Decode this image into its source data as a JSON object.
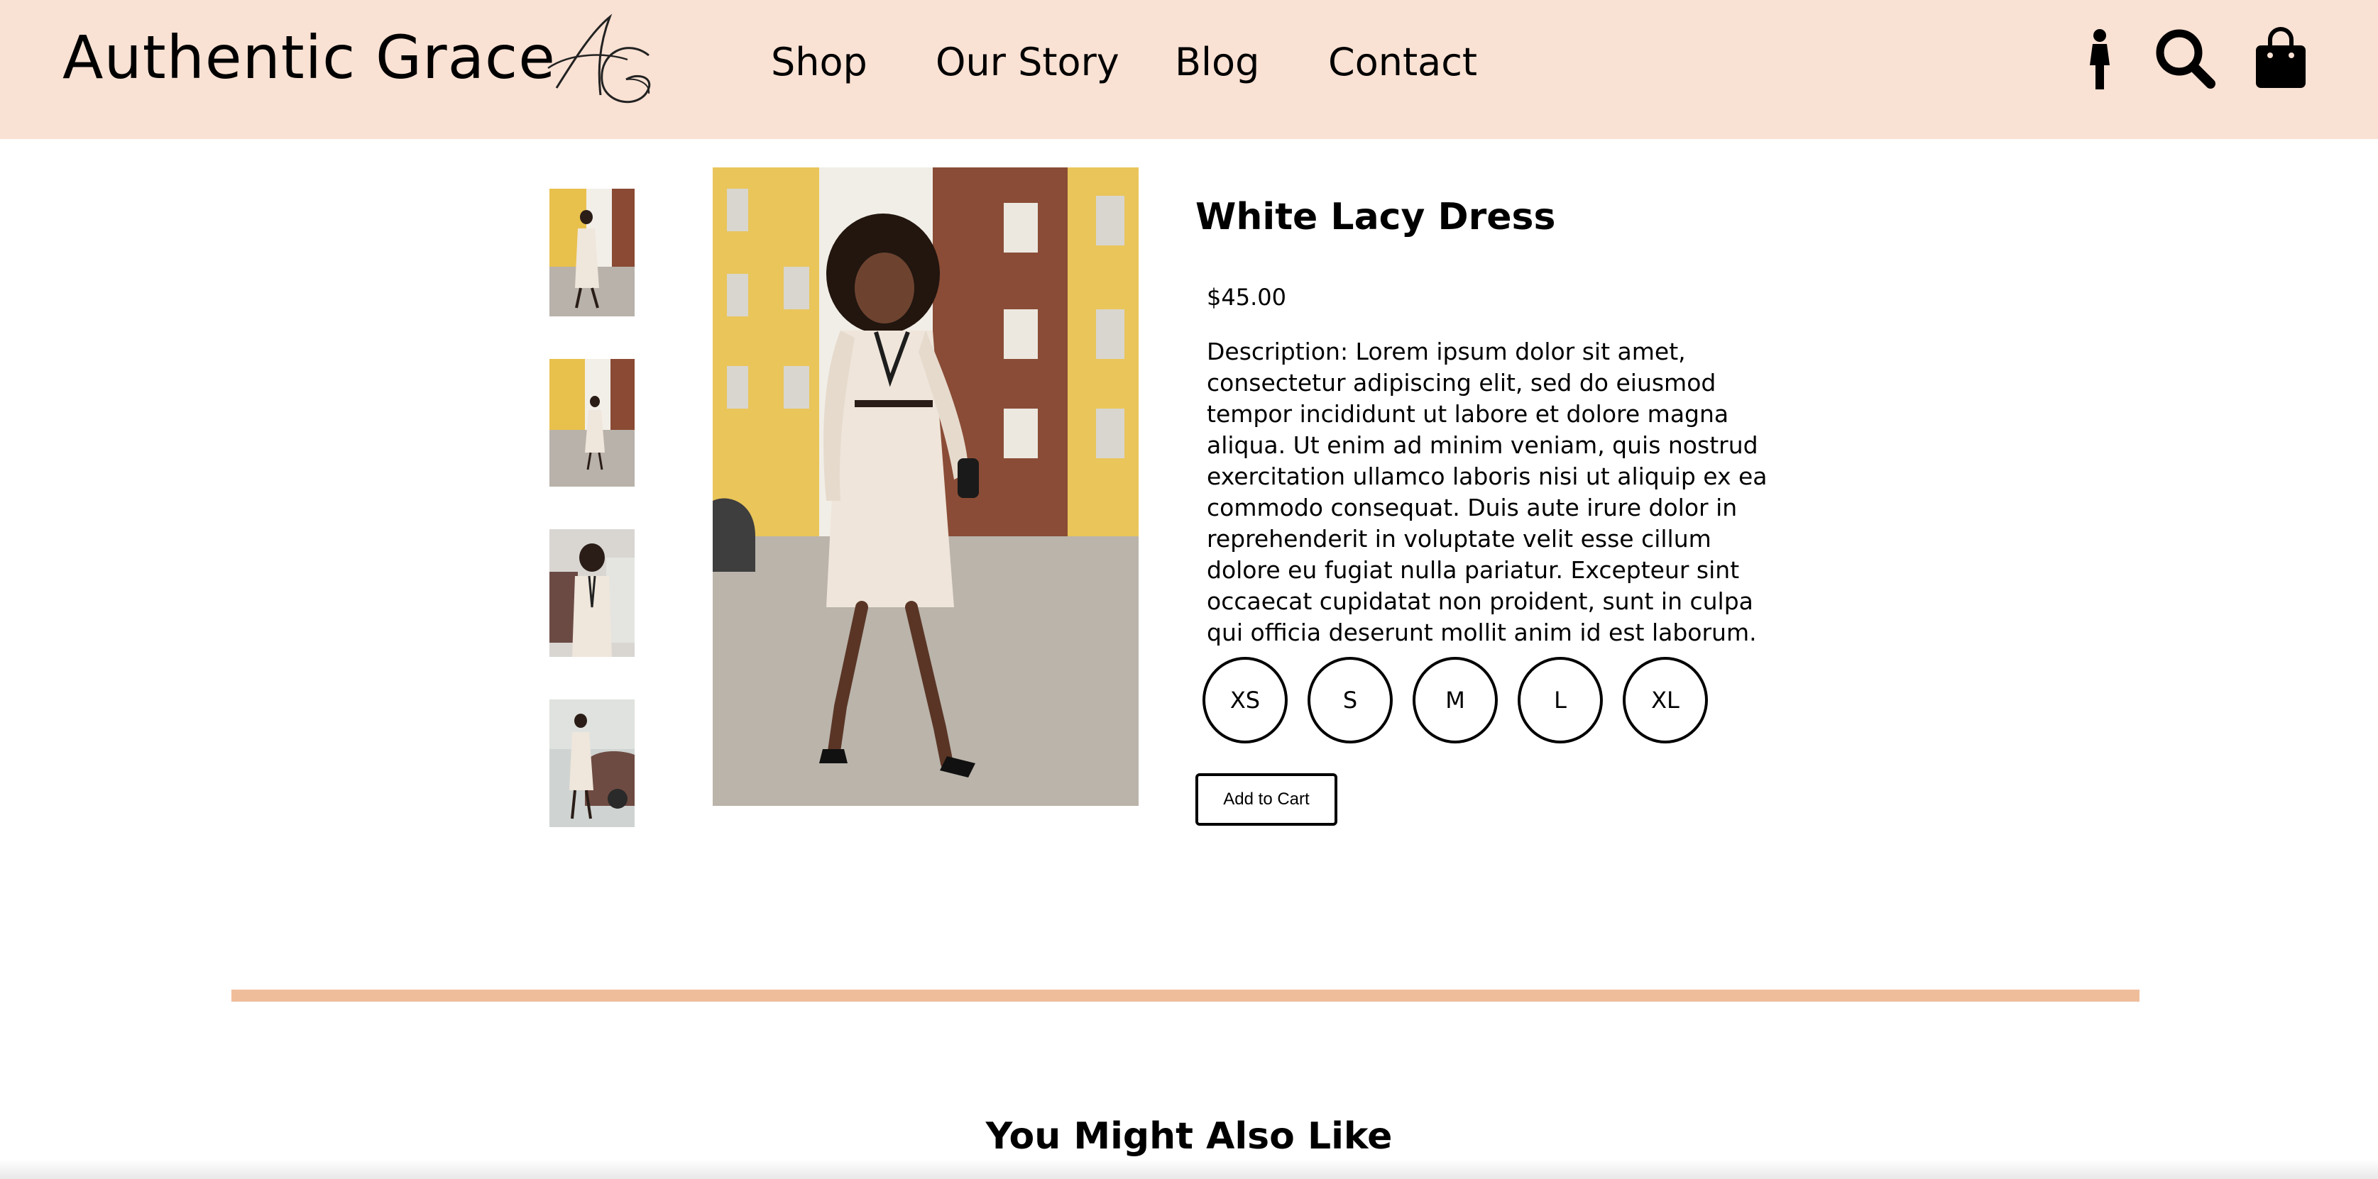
{
  "header": {
    "brand": "Authentic Grace",
    "nav": [
      "Shop",
      "Our Story",
      "Blog",
      "Contact"
    ],
    "icons": [
      "person-icon",
      "search-icon",
      "shopping-bag-icon"
    ],
    "background_color": "#f9e1d3"
  },
  "product": {
    "title": "White Lacy Dress",
    "price": "$45.00",
    "description": "Description: Lorem ipsum dolor sit amet, consectetur adipiscing elit, sed do eiusmod tempor incididunt ut labore et dolore magna aliqua. Ut enim ad minim veniam, quis nostrud exercitation ullamco laboris nisi ut aliquip ex ea commodo consequat. Duis aute irure dolor in reprehenderit in voluptate velit esse cillum dolore eu fugiat nulla pariatur. Excepteur sint occaecat cupidatat non proident, sunt in culpa qui officia deserunt mollit anim id est laborum.",
    "sizes": [
      "XS",
      "S",
      "M",
      "L",
      "XL"
    ],
    "add_to_cart": "Add to Cart"
  },
  "divider_color": "#f0bd9b",
  "also_like": {
    "title": "You Might Also Like"
  }
}
